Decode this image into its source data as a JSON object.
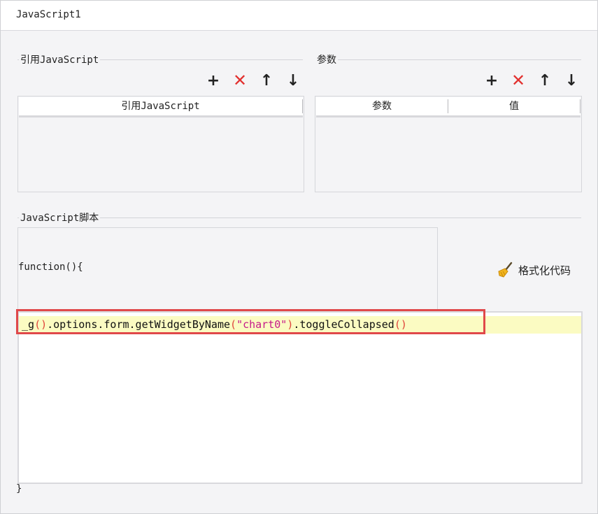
{
  "window": {
    "title": "JavaScript1"
  },
  "ref_section": {
    "legend": "引用JavaScript",
    "toolbar": {
      "add": "+",
      "delete": "✕",
      "up": "↑",
      "down": "↓"
    },
    "columns": [
      "引用JavaScript"
    ]
  },
  "param_section": {
    "legend": "参数",
    "toolbar": {
      "add": "+",
      "delete": "✕",
      "up": "↑",
      "down": "↓"
    },
    "columns": [
      "参数",
      "值"
    ]
  },
  "script_section": {
    "legend": "JavaScript脚本",
    "function_open": "function(){",
    "function_close": "}",
    "format_button": "格式化代码",
    "code": {
      "part1": "_g",
      "paren1": "()",
      "part2": ".options.form.getWidgetByName",
      "paren_open": "(",
      "string": "\"chart0\"",
      "paren_close": ")",
      "part3": ".toggleCollapsed",
      "paren2": "()"
    }
  },
  "colors": {
    "highlight_box": "#e0484a",
    "line_highlight": "#fbfbc2",
    "delete_icon": "#e2312f"
  }
}
